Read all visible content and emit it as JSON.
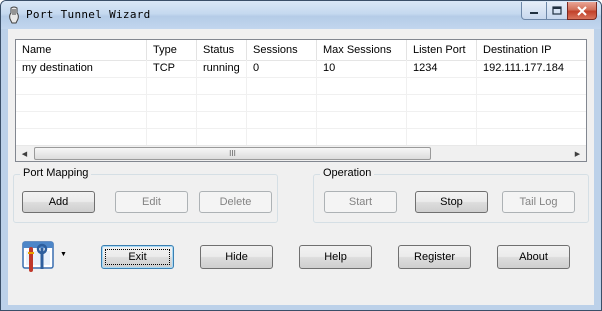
{
  "window": {
    "title": "Port Tunnel Wizard"
  },
  "list": {
    "columns": [
      "Name",
      "Type",
      "Status",
      "Sessions",
      "Max Sessions",
      "Listen Port",
      "Destination IP"
    ],
    "rows": [
      [
        "my destination",
        "TCP",
        "running",
        "0",
        "10",
        "1234",
        "192.111.177.184"
      ]
    ]
  },
  "port_mapping": {
    "label": "Port Mapping",
    "add": "Add",
    "edit": "Edit",
    "delete": "Delete"
  },
  "operation": {
    "label": "Operation",
    "start": "Start",
    "stop": "Stop",
    "tail_log": "Tail Log"
  },
  "footer": {
    "exit": "Exit",
    "hide": "Hide",
    "help": "Help",
    "register": "Register",
    "about": "About"
  }
}
